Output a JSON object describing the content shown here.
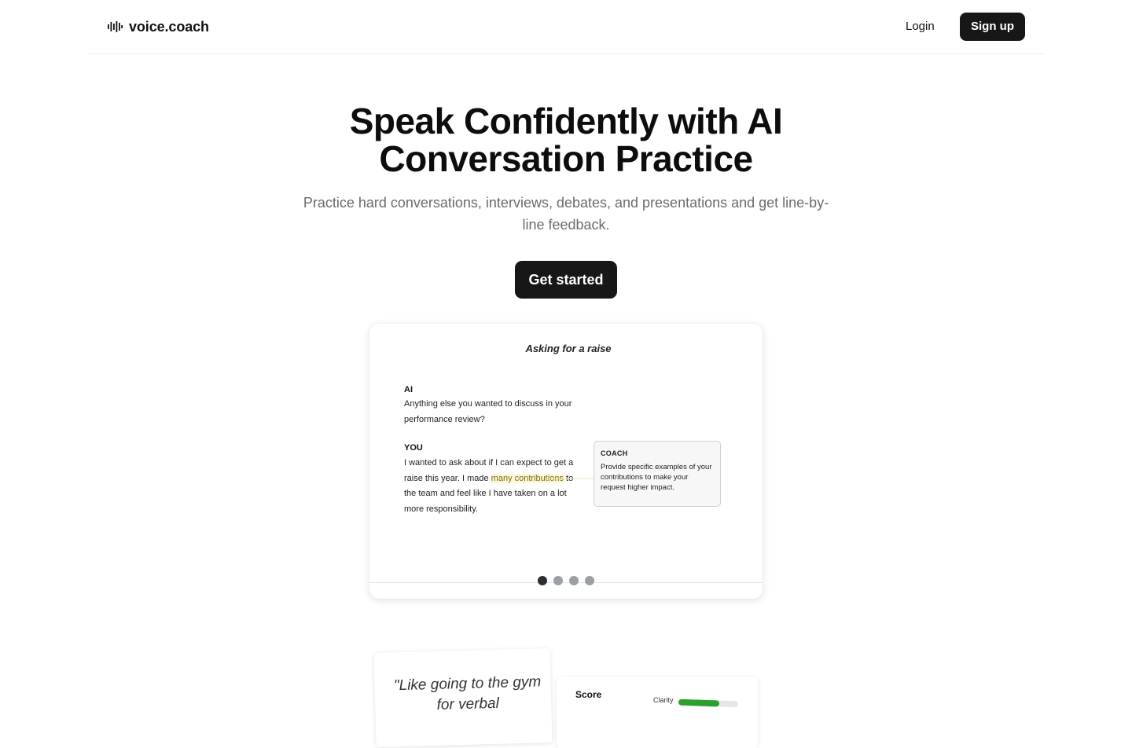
{
  "header": {
    "brand": "voice.coach",
    "brand_icon": "sound-wave-icon",
    "login_label": "Login",
    "signup_label": "Sign up"
  },
  "hero": {
    "title": "Speak Confidently with AI Conversation Practice",
    "subtitle": "Practice hard conversations, interviews, debates, and presentations and get line-by-line feedback.",
    "cta_label": "Get started"
  },
  "demo": {
    "scenario_title": "Asking for a raise",
    "ai_label": "AI",
    "ai_text": "Anything else you wanted to discuss in your performance review?",
    "you_label": "YOU",
    "you_text_before": "I wanted to ask about if I can expect to get a raise this year. I made ",
    "you_text_highlight": "many contributions",
    "you_text_after": " to the team and feel like I have taken on a lot more responsibility.",
    "coach_label": "COACH",
    "coach_text": "Provide specific examples of your contributions  to make your request higher impact.",
    "slide_count": 4,
    "active_slide": 1,
    "highlight_color": "#fdf8d9"
  },
  "bottom": {
    "quote": "\"Like going to the gym for verbal",
    "score_title": "Score",
    "metric_label": "Clarity",
    "metric_fill_fraction": 0.68,
    "metric_color": "#2ca02c"
  },
  "colors": {
    "primary": "#171717",
    "muted_text": "#6b6b6b",
    "dot_active": "#2b2f33",
    "dot_inactive": "#9aa0a6"
  }
}
